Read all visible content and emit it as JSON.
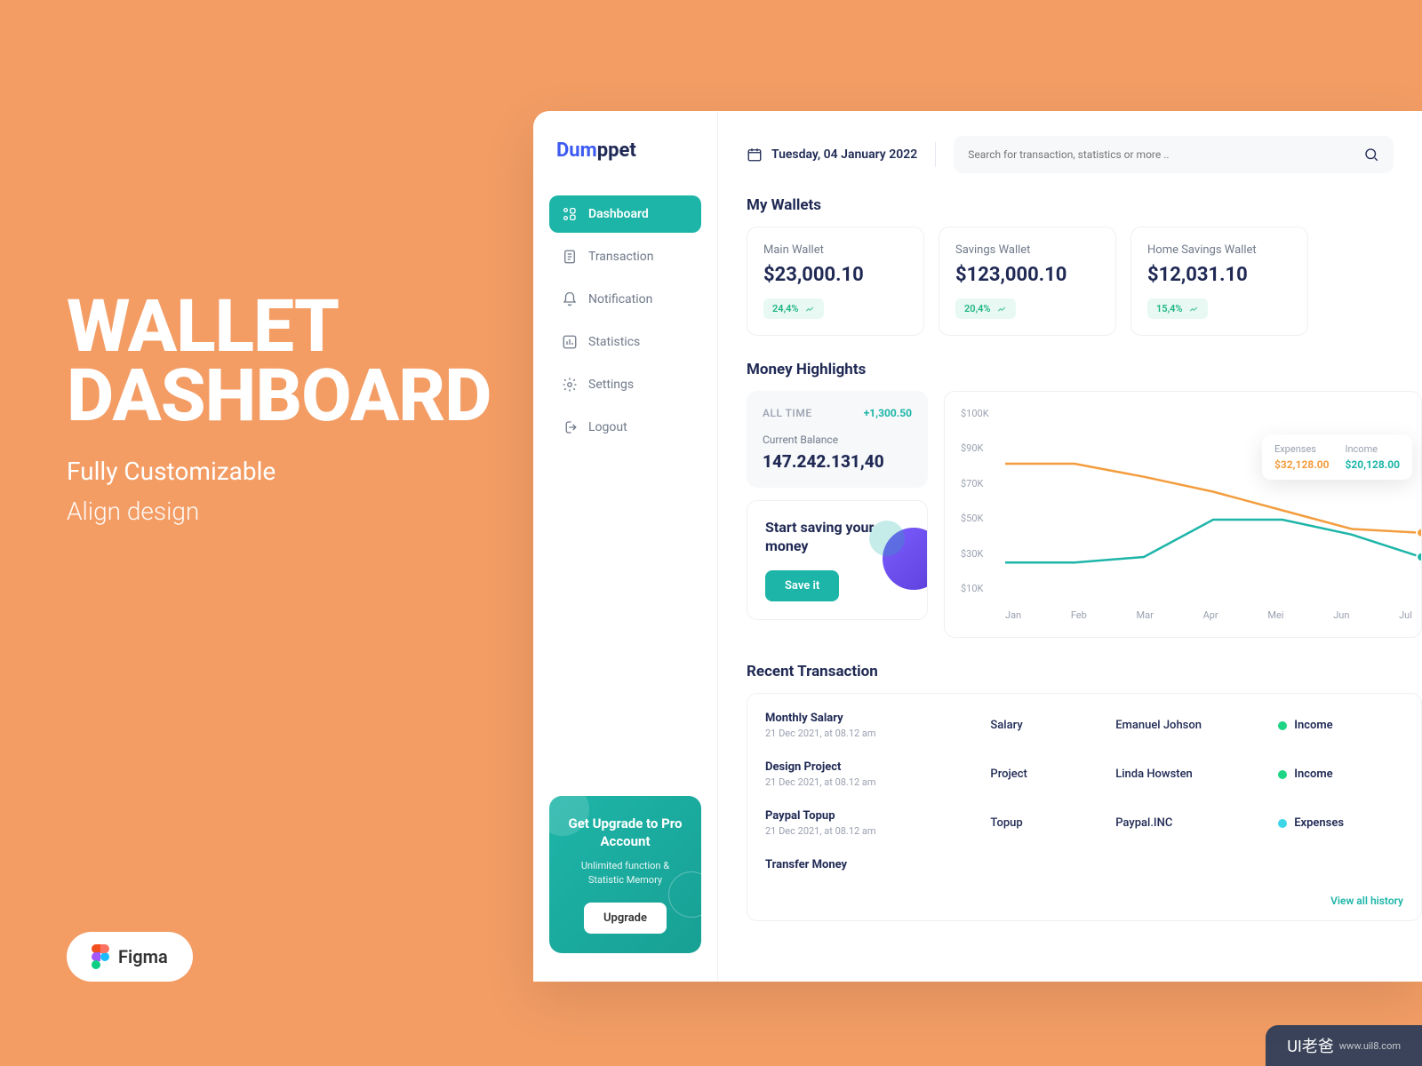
{
  "promo": {
    "title_line1": "WALLET",
    "title_line2": "DASHBOARD",
    "subtitle1": "Fully Customizable",
    "subtitle2": "Align design",
    "figma_label": "Figma"
  },
  "watermark": {
    "brand": "UI老爸",
    "url": "www.uil8.com"
  },
  "brand": {
    "part1": "Dum",
    "part2": "ppet"
  },
  "topbar": {
    "date": "Tuesday, 04 January 2022",
    "search_placeholder": "Search for transaction, statistics or more .."
  },
  "sidebar": {
    "items": [
      {
        "label": "Dashboard",
        "icon": "grid",
        "active": true
      },
      {
        "label": "Transaction",
        "icon": "receipt",
        "active": false
      },
      {
        "label": "Notification",
        "icon": "bell",
        "active": false
      },
      {
        "label": "Statistics",
        "icon": "chart",
        "active": false
      },
      {
        "label": "Settings",
        "icon": "gear",
        "active": false
      },
      {
        "label": "Logout",
        "icon": "logout",
        "active": false
      }
    ],
    "upgrade": {
      "title": "Get Upgrade to Pro Account",
      "subtitle": "Unlimited function & Statistic Memory",
      "button": "Upgrade"
    }
  },
  "wallets": {
    "section_title": "My  Wallets",
    "items": [
      {
        "name": "Main Wallet",
        "amount": "$23,000.10",
        "trend": "24,4%"
      },
      {
        "name": "Savings Wallet",
        "amount": "$123,000.10",
        "trend": "20,4%"
      },
      {
        "name": "Home Savings Wallet",
        "amount": "$12,031.10",
        "trend": "15,4%"
      }
    ]
  },
  "highlights": {
    "section_title": "Money Highlights",
    "all_time_label": "ALL TIME",
    "all_time_value": "+1,300.50",
    "balance_label": "Current Balance",
    "balance_value": "147.242.131,40",
    "save_title": "Start saving your money",
    "save_button": "Save it",
    "tooltip": {
      "expenses_label": "Expenses",
      "expenses_value": "$32,128.00",
      "income_label": "Income",
      "income_value": "$20,128.00"
    }
  },
  "chart_data": {
    "type": "line",
    "xlabel": "",
    "ylabel": "",
    "ylim": [
      0,
      100
    ],
    "y_ticks": [
      "$100K",
      "$90K",
      "$70K",
      "$50K",
      "$30K",
      "$10K"
    ],
    "categories": [
      "Jan",
      "Feb",
      "Mar",
      "Apr",
      "Mei",
      "Jun",
      "Jul"
    ],
    "series": [
      {
        "name": "Expenses",
        "color": "#f39d3e",
        "values": [
          70,
          70,
          63,
          55,
          45,
          35,
          33
        ]
      },
      {
        "name": "Income",
        "color": "#1db5a8",
        "values": [
          17,
          17,
          20,
          40,
          40,
          32,
          20
        ]
      }
    ]
  },
  "transactions": {
    "section_title": "Recent Transaction",
    "view_all": "View all history",
    "rows": [
      {
        "title": "Monthly Salary",
        "date": "21 Dec 2021, at 08.12 am",
        "category": "Salary",
        "person": "Emanuel Johson",
        "type": "Income",
        "kind": "income"
      },
      {
        "title": "Design Project",
        "date": "21 Dec 2021, at 08.12 am",
        "category": "Project",
        "person": "Linda Howsten",
        "type": "Income",
        "kind": "income"
      },
      {
        "title": "Paypal Topup",
        "date": "21 Dec 2021, at 08.12 am",
        "category": "Topup",
        "person": "Paypal.INC",
        "type": "Expenses",
        "kind": "expense"
      },
      {
        "title": "Transfer Money",
        "date": "",
        "category": "",
        "person": "",
        "type": "",
        "kind": ""
      }
    ]
  }
}
